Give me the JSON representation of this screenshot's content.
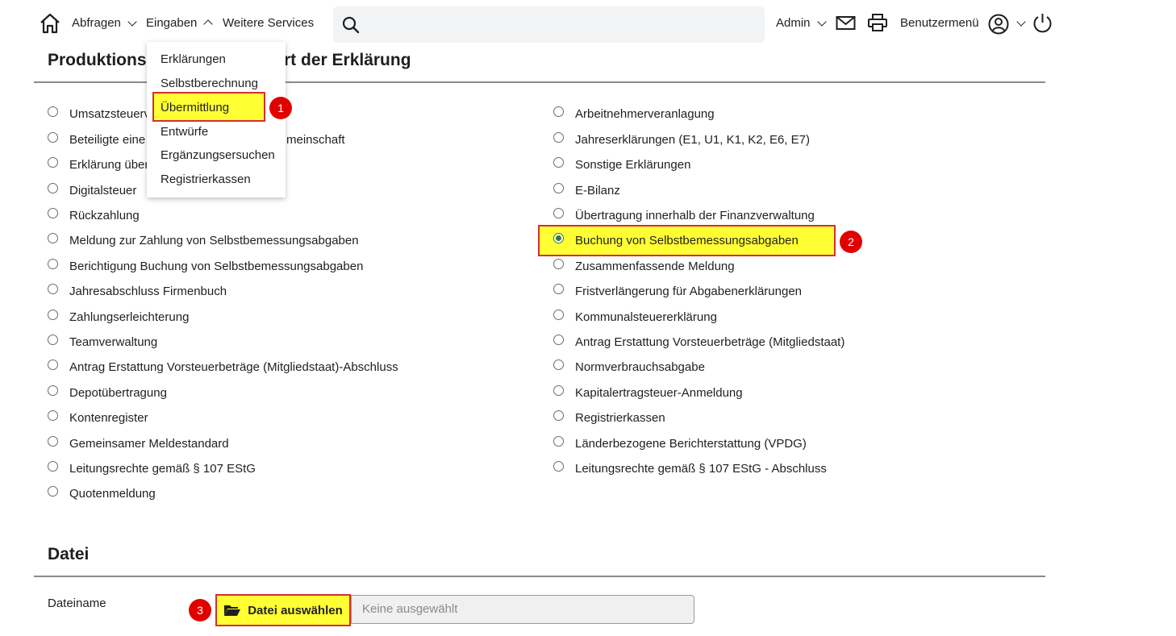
{
  "nav": {
    "abfragen": "Abfragen",
    "eingaben": "Eingaben",
    "weitere": "Weitere Services",
    "admin": "Admin",
    "benutzermenue": "Benutzermenü",
    "search_placeholder": ""
  },
  "section": {
    "title_left": "Produktions",
    "title_right": "rt der Erklärung",
    "file_title": "Datei"
  },
  "dropdown": {
    "items": [
      "Erklärungen",
      "Selbstberechnung",
      "Übermittlung",
      "Entwürfe",
      "Ergänzungsersuchen",
      "Registrierkassen"
    ]
  },
  "left_options": [
    "Umsatzsteuerv",
    "Beteiligte eine",
    "Erklärung über",
    "Digitalsteuer",
    "Rückzahlung",
    "Meldung zur Zahlung von Selbstbemessungsabgaben",
    "Berichtigung Buchung von Selbstbemessungsabgaben",
    "Jahresabschluss Firmenbuch",
    "Zahlungserleichterung",
    "Teamverwaltung",
    "Antrag Erstattung Vorsteuerbeträge (Mitgliedstaat)-Abschluss",
    "Depotübertragung",
    "Kontenregister",
    "Gemeinsamer Meldestandard",
    "Leitungsrechte gemäß § 107 EStG",
    "Quotenmeldung"
  ],
  "left_option_tail": "meinschaft",
  "right_options": [
    "Arbeitnehmerveranlagung",
    "Jahreserklärungen (E1, U1, K1, K2, E6, E7)",
    "Sonstige Erklärungen",
    "E-Bilanz",
    "Übertragung innerhalb der Finanzverwaltung",
    "Buchung von Selbstbemessungsabgaben",
    "Zusammenfassende Meldung",
    "Fristverlängerung für Abgabenerklärungen",
    "Kommunalsteuererklärung",
    "Antrag Erstattung Vorsteuerbeträge (Mitgliedstaat)",
    "Normverbrauchsabgabe",
    "Kapitalertragsteuer-Anmeldung",
    "Registrierkassen",
    "Länderbezogene Berichterstattung (VPDG)",
    "Leitungsrechte gemäß § 107 EStG - Abschluss"
  ],
  "selected_right_index": 5,
  "file": {
    "label": "Dateiname",
    "button": "Datei auswählen",
    "placeholder": "Keine ausgewählt"
  },
  "badges": [
    "1",
    "2",
    "3"
  ],
  "colors": {
    "highlight": "#ffff33",
    "marker": "#e00000",
    "selected": "#2e7d32"
  }
}
